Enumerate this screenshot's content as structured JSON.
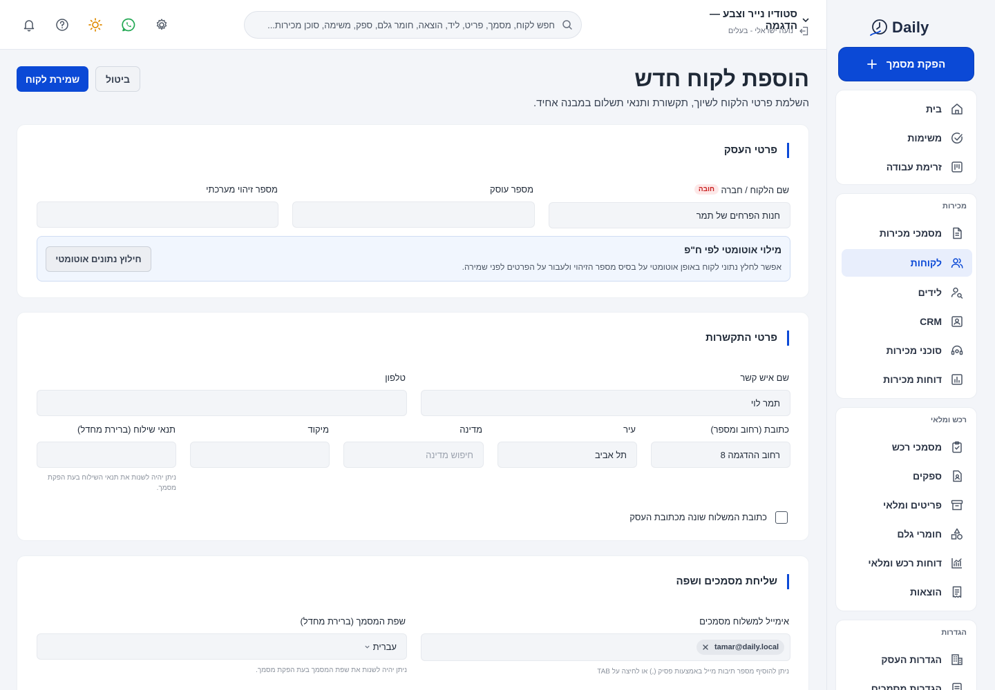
{
  "brand": {
    "name": "Daily",
    "accent": "#0b49d6"
  },
  "sidebar": {
    "new_doc_label": "הפקת מסמך",
    "groups": [
      {
        "title": "",
        "items": [
          {
            "label": "בית",
            "icon": "home-icon"
          },
          {
            "label": "משימות",
            "icon": "check-circle-icon"
          },
          {
            "label": "זרימת עבודה",
            "icon": "kanban-icon"
          }
        ]
      },
      {
        "title": "מכירות",
        "items": [
          {
            "label": "מסמכי מכירות",
            "icon": "document-icon"
          },
          {
            "label": "לקוחות",
            "icon": "users-icon",
            "active": true
          },
          {
            "label": "לידים",
            "icon": "user-search-icon"
          },
          {
            "label": "CRM",
            "icon": "contact-card-icon"
          },
          {
            "label": "סוכני מכירות",
            "icon": "headset-icon"
          },
          {
            "label": "דוחות מכירות",
            "icon": "bar-chart-icon"
          }
        ]
      },
      {
        "title": "רכש ומלאי",
        "items": [
          {
            "label": "מסמכי רכש",
            "icon": "clipboard-check-icon"
          },
          {
            "label": "ספקים",
            "icon": "supplier-doc-icon"
          },
          {
            "label": "פריטים ומלאי",
            "icon": "archive-icon"
          },
          {
            "label": "חומרי גלם",
            "icon": "shapes-icon"
          },
          {
            "label": "דוחות רכש ומלאי",
            "icon": "trend-chart-icon"
          },
          {
            "label": "הוצאות",
            "icon": "receipt-icon"
          }
        ]
      },
      {
        "title": "הגדרות",
        "items": [
          {
            "label": "הגדרות העסק",
            "icon": "building-icon"
          },
          {
            "label": "הגדרות מסמכים",
            "icon": "document-settings-icon"
          }
        ]
      }
    ]
  },
  "topbar": {
    "business_name": "סטודיו נייר וצבע — הדגמה",
    "user_line": "נועה ישראלי - בעלים",
    "search_placeholder": "חפש לקוח, מסמך, פריט, ליד, הוצאה, חומר גלם, ספק, משימה, סוכן מכירות...",
    "icons": [
      "settings-icon",
      "whatsapp-icon",
      "sun-icon",
      "help-icon",
      "bell-icon"
    ]
  },
  "page": {
    "title": "הוספת לקוח חדש",
    "subtitle": "השלמת פרטי הלקוח לשיוך, תקשורת ותנאי תשלום במבנה אחיד.",
    "save_label": "שמירת לקוח",
    "cancel_label": "ביטול"
  },
  "business_card": {
    "title": "פרטי העסק",
    "name_label": "שם הלקוח / חברה",
    "required_badge": "חובה",
    "name_value": "חנות הפרחים של תמר",
    "dealer_label": "מספר עוסק",
    "dealer_value": "",
    "system_id_label": "מספר זיהוי מערכתי",
    "system_id_value": "",
    "auto_title": "מילוי אוטומטי לפי ח\"פ",
    "auto_desc": "אפשר לחלץ נתוני לקוח באופן אוטומטי על בסיס מספר הזיהוי ולעבור על הפרטים לפני שמירה.",
    "auto_button": "חילוץ נתונים אוטומטי"
  },
  "contact_card": {
    "title": "פרטי התקשרות",
    "contact_label": "שם איש קשר",
    "contact_value": "תמר לוי",
    "phone_label": "טלפון",
    "phone_value": "",
    "address_label": "כתובת (רחוב ומספר)",
    "address_value": "רחוב ההדגמה 8",
    "city_label": "עיר",
    "city_value": "תל אביב",
    "country_label": "מדינה",
    "country_placeholder": "חיפוש מדינה",
    "zip_label": "מיקוד",
    "zip_value": "",
    "shipping_label": "תנאי שילוח (ברירת מחדל)",
    "shipping_value": "",
    "shipping_hint": "ניתן יהיה לשנות את תנאי השילוח בעת הפקת מסמך.",
    "checkbox_label": "כתובת המשלוח שונה מכתובת העסק"
  },
  "docs_card": {
    "title": "שליחת מסמכים ושפה",
    "email_label": "אימייל למשלוח מסמכים",
    "email_chip": "tamar@daily.local",
    "email_hint": "ניתן להוסיף מספר תיבות מייל באמצעות פסיק (,) או לחיצה על TAB",
    "lang_label": "שפת המסמך (ברירת מחדל)",
    "lang_value": "עברית",
    "lang_hint": "ניתן יהיה לשנות את שפת המסמך בעת הפקת מסמך."
  }
}
